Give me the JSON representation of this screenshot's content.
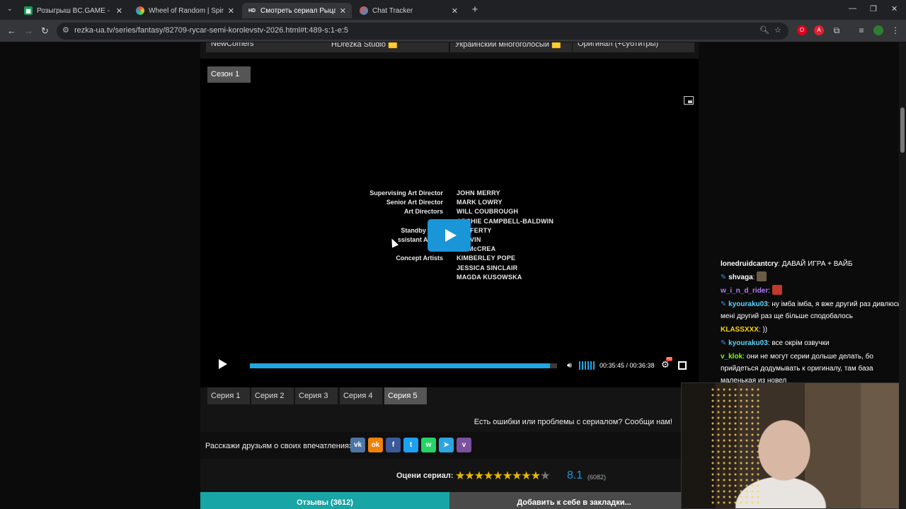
{
  "browser": {
    "tabs": [
      {
        "title": "Розыгрыш BC.GAME - Google",
        "favicon": "sheets-icon",
        "active": false
      },
      {
        "title": "Wheel of Random | Spin to De",
        "favicon": "wheel-icon",
        "active": false
      },
      {
        "title": "Смотреть сериал Рыцарь Семи",
        "favicon": "hd-icon",
        "active": true
      },
      {
        "title": "Chat Tracker",
        "favicon": "chat-icon",
        "active": false
      }
    ],
    "url": "rezka-ua.tv/series/fantasy/82709-rycar-semi-korolevstv-2026.html#t:489-s:1-e:5",
    "hd_fav": "HD"
  },
  "translators": [
    "NewComers",
    "HDrezka Studio 🟨",
    "Украинский многоголосый 🟨",
    "Оригинал (+субтитры)"
  ],
  "player": {
    "season_label": "Сезон 1",
    "credits_roles": [
      "Supervising Art Director",
      "Senior Art Director",
      "Art Directors",
      "",
      "Standby Art D",
      "ssistant Art Dir",
      "",
      "Concept Artists",
      "",
      ""
    ],
    "credits_names": [
      "JOHN MERRY",
      "MARK LOWRY",
      "WILL COUBROUGH",
      "ARCHIE CAMPBELL-BALDWIN",
      "   RAFFERTY",
      "   GALVIN",
      "   AN McCREA",
      "KIMBERLEY POPE",
      "JESSICA SINCLAIR",
      "MAGDA KUSOWSKA"
    ],
    "time": "00:35:45 / 00:36:38",
    "progress": 0.976,
    "hd_badge": "HD"
  },
  "episodes": [
    "Серия 1",
    "Серия 2",
    "Серия 3",
    "Серия 4",
    "Серия 5"
  ],
  "active_episode": 4,
  "error_text": "Есть ошибки или проблемы с сериалом? Сообщи нам!",
  "share": {
    "label": "Расскажи друзьям о своих впечатлениях:",
    "networks": [
      {
        "name": "vk",
        "glyph": "vk",
        "color": "#4c75a3"
      },
      {
        "name": "ok",
        "glyph": "ok",
        "color": "#ee8208"
      },
      {
        "name": "facebook",
        "glyph": "f",
        "color": "#3b5998"
      },
      {
        "name": "twitter",
        "glyph": "t",
        "color": "#1da1f2"
      },
      {
        "name": "whatsapp",
        "glyph": "w",
        "color": "#25d366"
      },
      {
        "name": "telegram",
        "glyph": "➤",
        "color": "#2ca5e0"
      },
      {
        "name": "viber",
        "glyph": "v",
        "color": "#7b519d"
      }
    ]
  },
  "rating": {
    "label": "Оцени сериал:",
    "score": "8.1",
    "votes": "(6082)",
    "stars_on": 9,
    "stars_total": 10
  },
  "buttons": {
    "reviews": "Отзывы (3612)",
    "bookmark": "Добавить к себе в закладки..."
  },
  "chat": [
    {
      "user": "lonedruidcantcry",
      "text": "ДАВАЙ ИГРА + ВАЙБ",
      "color": "#ffffff",
      "badge": false
    },
    {
      "user": "shvaga",
      "text": "",
      "color": "#ffffff",
      "badge": true,
      "emote": "#6b5b45"
    },
    {
      "user": "w_i_n_d_rider",
      "text": "",
      "color": "#b57bff",
      "badge": false,
      "emote": "#c0392b"
    },
    {
      "user": "kyouraku03",
      "text": "ну імба імба, я вже другий раз дивлюсь і мені другий раз ще більше сподобалось",
      "color": "#5bd6ff",
      "badge": true
    },
    {
      "user": "KLASSXXX",
      "text": "))",
      "color": "#ffd400",
      "badge": false
    },
    {
      "user": "kyouraku03",
      "text": "все окрім озвучки",
      "color": "#5bd6ff",
      "badge": true
    },
    {
      "user": "v_klok",
      "text": "они не могут серии дольше делать, бо прийдеться додумывать к оригиналу, там база маленькая из новел",
      "color": "#7cfc00",
      "badge": false
    }
  ]
}
